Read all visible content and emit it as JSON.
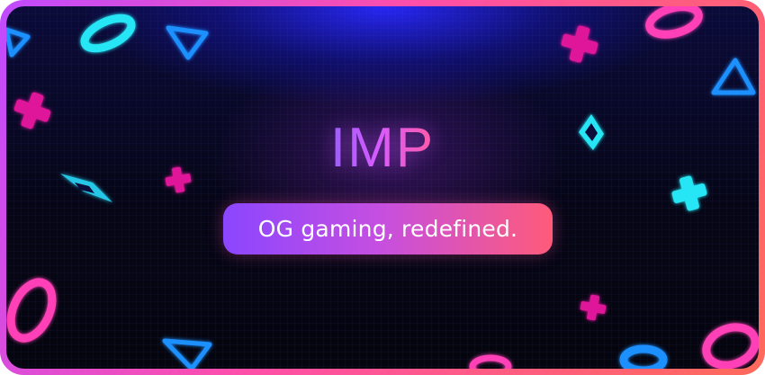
{
  "banner": {
    "logo_text": "IMP",
    "tagline": "OG gaming, redefined."
  },
  "colors": {
    "border_gradient": [
      "#c04bff",
      "#ff4fa8",
      "#ff6a5a"
    ],
    "background": "#060617",
    "glow_blue": "#2828ff",
    "cyan": "#25e6f5",
    "magenta": "#ff2fb0",
    "blue": "#1e90ff",
    "tagline_gradient": [
      "#8b46ff",
      "#c64fe0",
      "#ff5b7a"
    ]
  },
  "decorations": [
    "triangle-icon",
    "ring-icon",
    "plus-icon",
    "diamond-icon"
  ]
}
